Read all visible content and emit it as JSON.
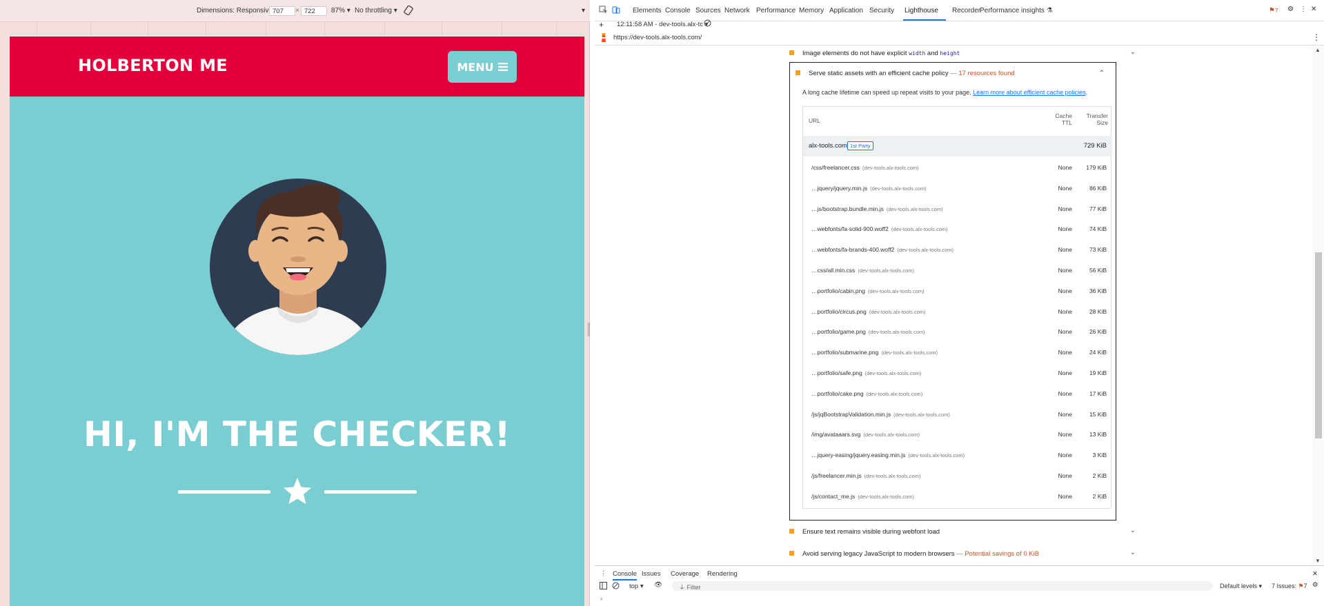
{
  "device_toolbar": {
    "dimensions_label": "Dimensions: Responsive",
    "width": "707",
    "times": "×",
    "height": "722",
    "zoom": "87%",
    "throttling": "No throttling"
  },
  "site": {
    "brand": "HOLBERTON ME",
    "menu_label": "MENU",
    "hero_title": "HI, I'M THE CHECKER!",
    "colors": {
      "nav": "#e4003a",
      "body": "#7acdd0"
    }
  },
  "devtools": {
    "tabs": [
      "Elements",
      "Console",
      "Sources",
      "Network",
      "Performance",
      "Memory",
      "Application",
      "Security",
      "Lighthouse",
      "Recorder",
      "Performance insights"
    ],
    "active_tab": "Lighthouse",
    "issues_badge": "7",
    "report_time": "12:11:58 AM - dev-tools.alx-tc",
    "url": "https://dev-tools.alx-tools.com/"
  },
  "audits": {
    "image_dims": {
      "prefix": "Image elements do not have explicit ",
      "code1": "width",
      "mid": " and ",
      "code2": "height"
    },
    "cache": {
      "title": "Serve static assets with an efficient cache policy",
      "sep": " — ",
      "found": "17 resources found",
      "description": "A long cache lifetime can speed up repeat visits to your page. ",
      "link": "Learn more about efficient cache policies",
      "link_suffix": ".",
      "col_url": "URL",
      "col_ttl_1": "Cache",
      "col_ttl_2": "TTL",
      "col_size_1": "Transfer",
      "col_size_2": "Size",
      "group": {
        "domain": "alx-tools.com",
        "badge": "1st Party",
        "size": "729 KiB"
      },
      "rows": [
        {
          "url": "/css/freelancer.css",
          "host": "(dev-tools.alx-tools.com)",
          "ttl": "None",
          "size": "179 KiB"
        },
        {
          "url": "…jquery/jquery.min.js",
          "host": "(dev-tools.alx-tools.com)",
          "ttl": "None",
          "size": "86 KiB"
        },
        {
          "url": "…js/bootstrap.bundle.min.js",
          "host": "(dev-tools.alx-tools.com)",
          "ttl": "None",
          "size": "77 KiB"
        },
        {
          "url": "…webfonts/fa-solid-900.woff2",
          "host": "(dev-tools.alx-tools.com)",
          "ttl": "None",
          "size": "74 KiB"
        },
        {
          "url": "…webfonts/fa-brands-400.woff2",
          "host": "(dev-tools.alx-tools.com)",
          "ttl": "None",
          "size": "73 KiB"
        },
        {
          "url": "…css/all.min.css",
          "host": "(dev-tools.alx-tools.com)",
          "ttl": "None",
          "size": "56 KiB"
        },
        {
          "url": "…portfolio/cabin.png",
          "host": "(dev-tools.alx-tools.com)",
          "ttl": "None",
          "size": "36 KiB"
        },
        {
          "url": "…portfolio/circus.png",
          "host": "(dev-tools.alx-tools.com)",
          "ttl": "None",
          "size": "28 KiB"
        },
        {
          "url": "…portfolio/game.png",
          "host": "(dev-tools.alx-tools.com)",
          "ttl": "None",
          "size": "26 KiB"
        },
        {
          "url": "…portfolio/submarine.png",
          "host": "(dev-tools.alx-tools.com)",
          "ttl": "None",
          "size": "24 KiB"
        },
        {
          "url": "…portfolio/safe.png",
          "host": "(dev-tools.alx-tools.com)",
          "ttl": "None",
          "size": "19 KiB"
        },
        {
          "url": "…portfolio/cake.png",
          "host": "(dev-tools.alx-tools.com)",
          "ttl": "None",
          "size": "17 KiB"
        },
        {
          "url": "/js/jqBootstrapValidation.min.js",
          "host": "(dev-tools.alx-tools.com)",
          "ttl": "None",
          "size": "15 KiB"
        },
        {
          "url": "/img/avataaars.svg",
          "host": "(dev-tools.alx-tools.com)",
          "ttl": "None",
          "size": "13 KiB"
        },
        {
          "url": "…jquery-easing/jquery.easing.min.js",
          "host": "(dev-tools.alx-tools.com)",
          "ttl": "None",
          "size": "3 KiB"
        },
        {
          "url": "/js/freelancer.min.js",
          "host": "(dev-tools.alx-tools.com)",
          "ttl": "None",
          "size": "2 KiB"
        },
        {
          "url": "/js/contact_me.js",
          "host": "(dev-tools.alx-tools.com)",
          "ttl": "None",
          "size": "2 KiB"
        }
      ]
    },
    "webfont": "Ensure text remains visible during webfont load",
    "legacy": {
      "title": "Avoid serving legacy JavaScript to modern browsers",
      "sep": " — ",
      "savings": "Potential savings of 0 KiB"
    }
  },
  "drawer": {
    "tabs": [
      "Console",
      "Issues",
      "Coverage",
      "Rendering"
    ],
    "context": "top",
    "filter_placeholder": "Filter",
    "levels": "Default levels",
    "issues_label": "7 Issues:",
    "issues_count": "7",
    "prompt": "›"
  }
}
